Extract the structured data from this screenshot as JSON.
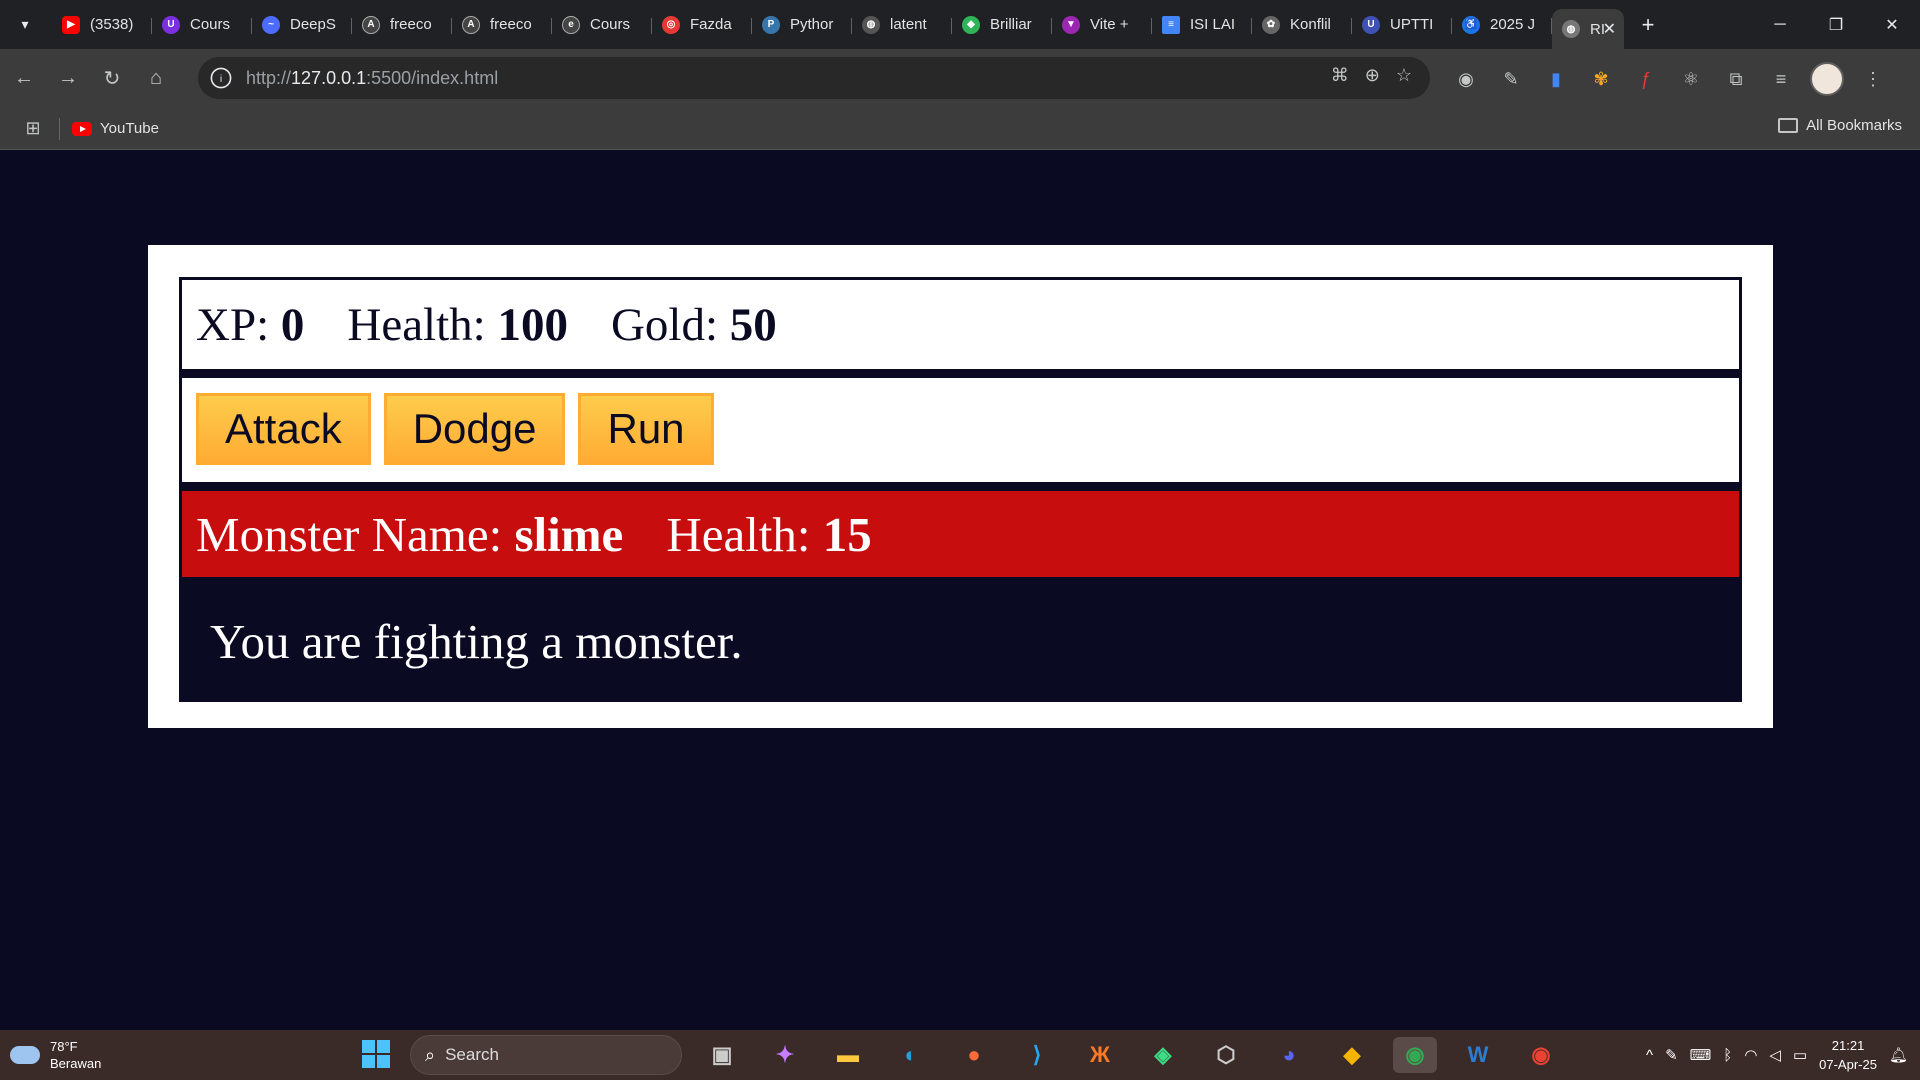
{
  "browser": {
    "tabs": [
      {
        "label": "(3538)",
        "color": "#ff0000",
        "icon": "youtube-icon"
      },
      {
        "label": "Cours",
        "color": "#7b2fe0",
        "icon": "course-icon"
      },
      {
        "label": "DeepS",
        "color": "#4d6bfe",
        "icon": "deepseek-icon"
      },
      {
        "label": "freeco",
        "color": "#444444",
        "icon": "freecodecamp-icon"
      },
      {
        "label": "freeco",
        "color": "#444444",
        "icon": "freecodecamp-icon"
      },
      {
        "label": "Cours",
        "color": "#444444",
        "icon": "edx-icon"
      },
      {
        "label": "Fazda",
        "color": "#e53935",
        "icon": "site-icon"
      },
      {
        "label": "Pythor",
        "color": "#3776ab",
        "icon": "python-icon"
      },
      {
        "label": "latent",
        "color": "#555555",
        "icon": "globe-icon"
      },
      {
        "label": "Brilliar",
        "color": "#2fb457",
        "icon": "brilliant-icon"
      },
      {
        "label": "Vite +",
        "color": "#9c27b0",
        "icon": "vite-icon"
      },
      {
        "label": "ISI LAI",
        "color": "#4285f4",
        "icon": "docs-icon"
      },
      {
        "label": "Konflil",
        "color": "#666666",
        "icon": "chatgpt-icon"
      },
      {
        "label": "UPTTI",
        "color": "#3f51b5",
        "icon": "site-icon"
      },
      {
        "label": "2025 J",
        "color": "#1a73e8",
        "icon": "accessibility-icon"
      }
    ],
    "active_tab": {
      "label": "RI",
      "close": "✕"
    },
    "new_tab": "+",
    "window_controls": {
      "minimize": "─",
      "restore": "❐",
      "close": "✕"
    },
    "url": {
      "scheme": "http://",
      "host": "127.0.0.1",
      "rest": ":5500/index.html"
    },
    "bookmarks": {
      "youtube": "YouTube",
      "all": "All Bookmarks"
    }
  },
  "game": {
    "stats": {
      "xp_label": "XP:",
      "xp": "0",
      "health_label": "Health:",
      "health": "100",
      "gold_label": "Gold:",
      "gold": "50"
    },
    "buttons": [
      "Attack",
      "Dodge",
      "Run"
    ],
    "monster": {
      "name_label": "Monster Name:",
      "name": "slime",
      "health_label": "Health:",
      "health": "15"
    },
    "text": "You are fighting a monster."
  },
  "taskbar": {
    "weather": {
      "temp": "78°F",
      "condition": "Berawan"
    },
    "search_placeholder": "Search",
    "clock": {
      "time": "21:21",
      "date": "07-Apr-25"
    }
  }
}
